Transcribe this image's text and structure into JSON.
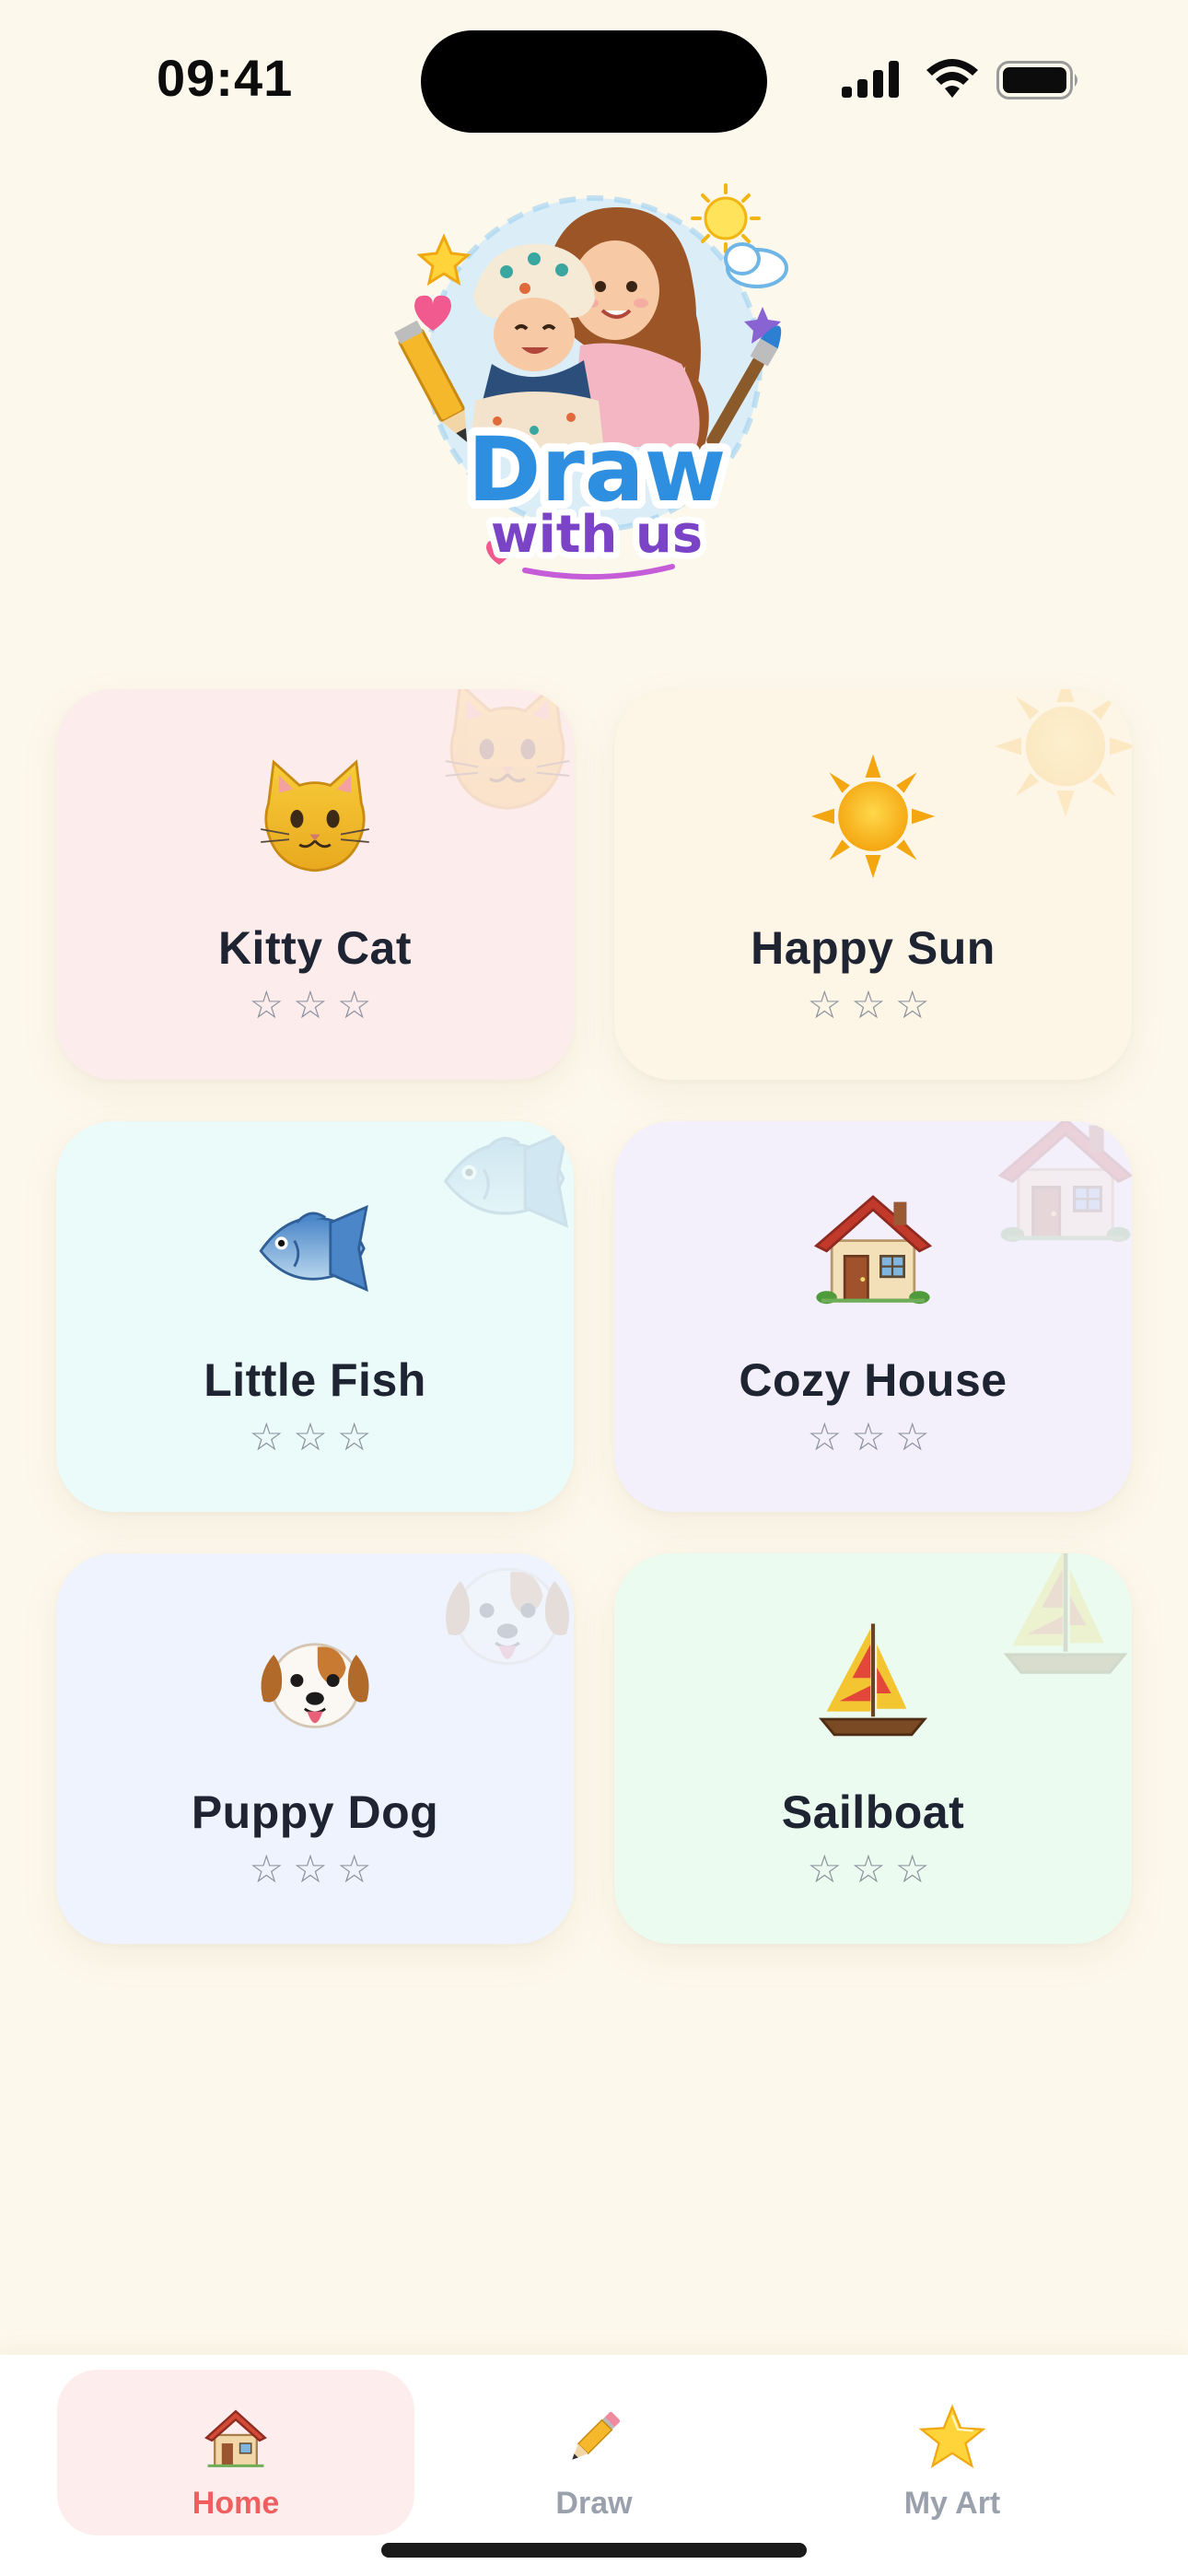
{
  "status_bar": {
    "time": "09:41"
  },
  "logo": {
    "line1": "Draw",
    "line2": "with us"
  },
  "cards": [
    {
      "title": "Kitty Cat",
      "stars": "☆☆☆",
      "icon": "cat-face-icon",
      "background": "#fdecec"
    },
    {
      "title": "Happy Sun",
      "stars": "☆☆☆",
      "icon": "sun-icon",
      "background": "#fdf5e6"
    },
    {
      "title": "Little Fish",
      "stars": "☆☆☆",
      "icon": "fish-icon",
      "background": "#ebfbfa"
    },
    {
      "title": "Cozy House",
      "stars": "☆☆☆",
      "icon": "house-icon",
      "background": "#f3f0fc"
    },
    {
      "title": "Puppy Dog",
      "stars": "☆☆☆",
      "icon": "dog-face-icon",
      "background": "#eef3fd"
    },
    {
      "title": "Sailboat",
      "stars": "☆☆☆",
      "icon": "sailboat-icon",
      "background": "#ebfbef"
    }
  ],
  "tab_bar": {
    "tabs": [
      {
        "label": "Home",
        "icon": "house-icon",
        "active": true
      },
      {
        "label": "Draw",
        "icon": "pencil-icon",
        "active": false
      },
      {
        "label": "My Art",
        "icon": "star-icon",
        "active": false
      }
    ],
    "active_color": "#ef5f5f",
    "inactive_color": "#9aa0ac"
  }
}
